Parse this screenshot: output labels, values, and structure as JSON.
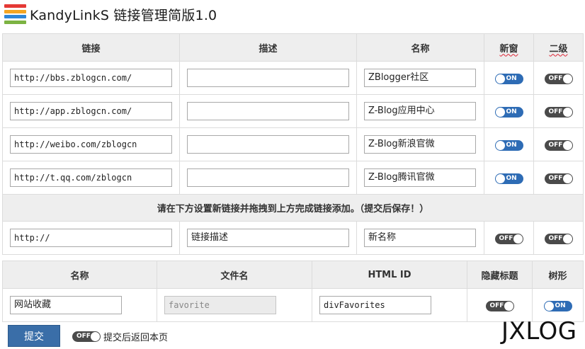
{
  "header": {
    "title": "KandyLinkS 链接管理简版1.0",
    "logo_colors": [
      "#e53935",
      "#f5a623",
      "#2f86d8",
      "#7cb342"
    ]
  },
  "links_table": {
    "headers": [
      "链接",
      "描述",
      "名称",
      "新窗",
      "二级"
    ],
    "rows": [
      {
        "url": "http://bbs.zblogcn.com/",
        "desc": "",
        "name": "ZBlogger社区",
        "new_window": "ON",
        "secondary": "OFF"
      },
      {
        "url": "http://app.zblogcn.com/",
        "desc": "",
        "name": "Z-Blog应用中心",
        "new_window": "ON",
        "secondary": "OFF"
      },
      {
        "url": "http://weibo.com/zblogcn",
        "desc": "",
        "name": "Z-Blog新浪官微",
        "new_window": "ON",
        "secondary": "OFF"
      },
      {
        "url": "http://t.qq.com/zblogcn",
        "desc": "",
        "name": "Z-Blog腾讯官微",
        "new_window": "ON",
        "secondary": "OFF"
      }
    ],
    "instruction": "请在下方设置新链接并拖拽到上方完成链接添加。（提交后保存！）",
    "new_row": {
      "url": "http://",
      "desc": "链接描述",
      "name": "新名称",
      "new_window": "OFF",
      "secondary": "OFF"
    }
  },
  "settings_table": {
    "headers": [
      "名称",
      "文件名",
      "HTML ID",
      "隐藏标题",
      "树形"
    ],
    "row": {
      "name": "网站收藏",
      "filename": "favorite",
      "html_id": "divFavorites",
      "hide_title": "OFF",
      "tree": "ON"
    }
  },
  "footer": {
    "submit_label": "提交",
    "return_toggle": "OFF",
    "return_label": "提交后返回本页"
  },
  "watermark": "JXLOG",
  "colors": {
    "toggle_on": "#2e6cb5",
    "toggle_off": "#4a4a4a",
    "submit": "#3a6ea8"
  }
}
